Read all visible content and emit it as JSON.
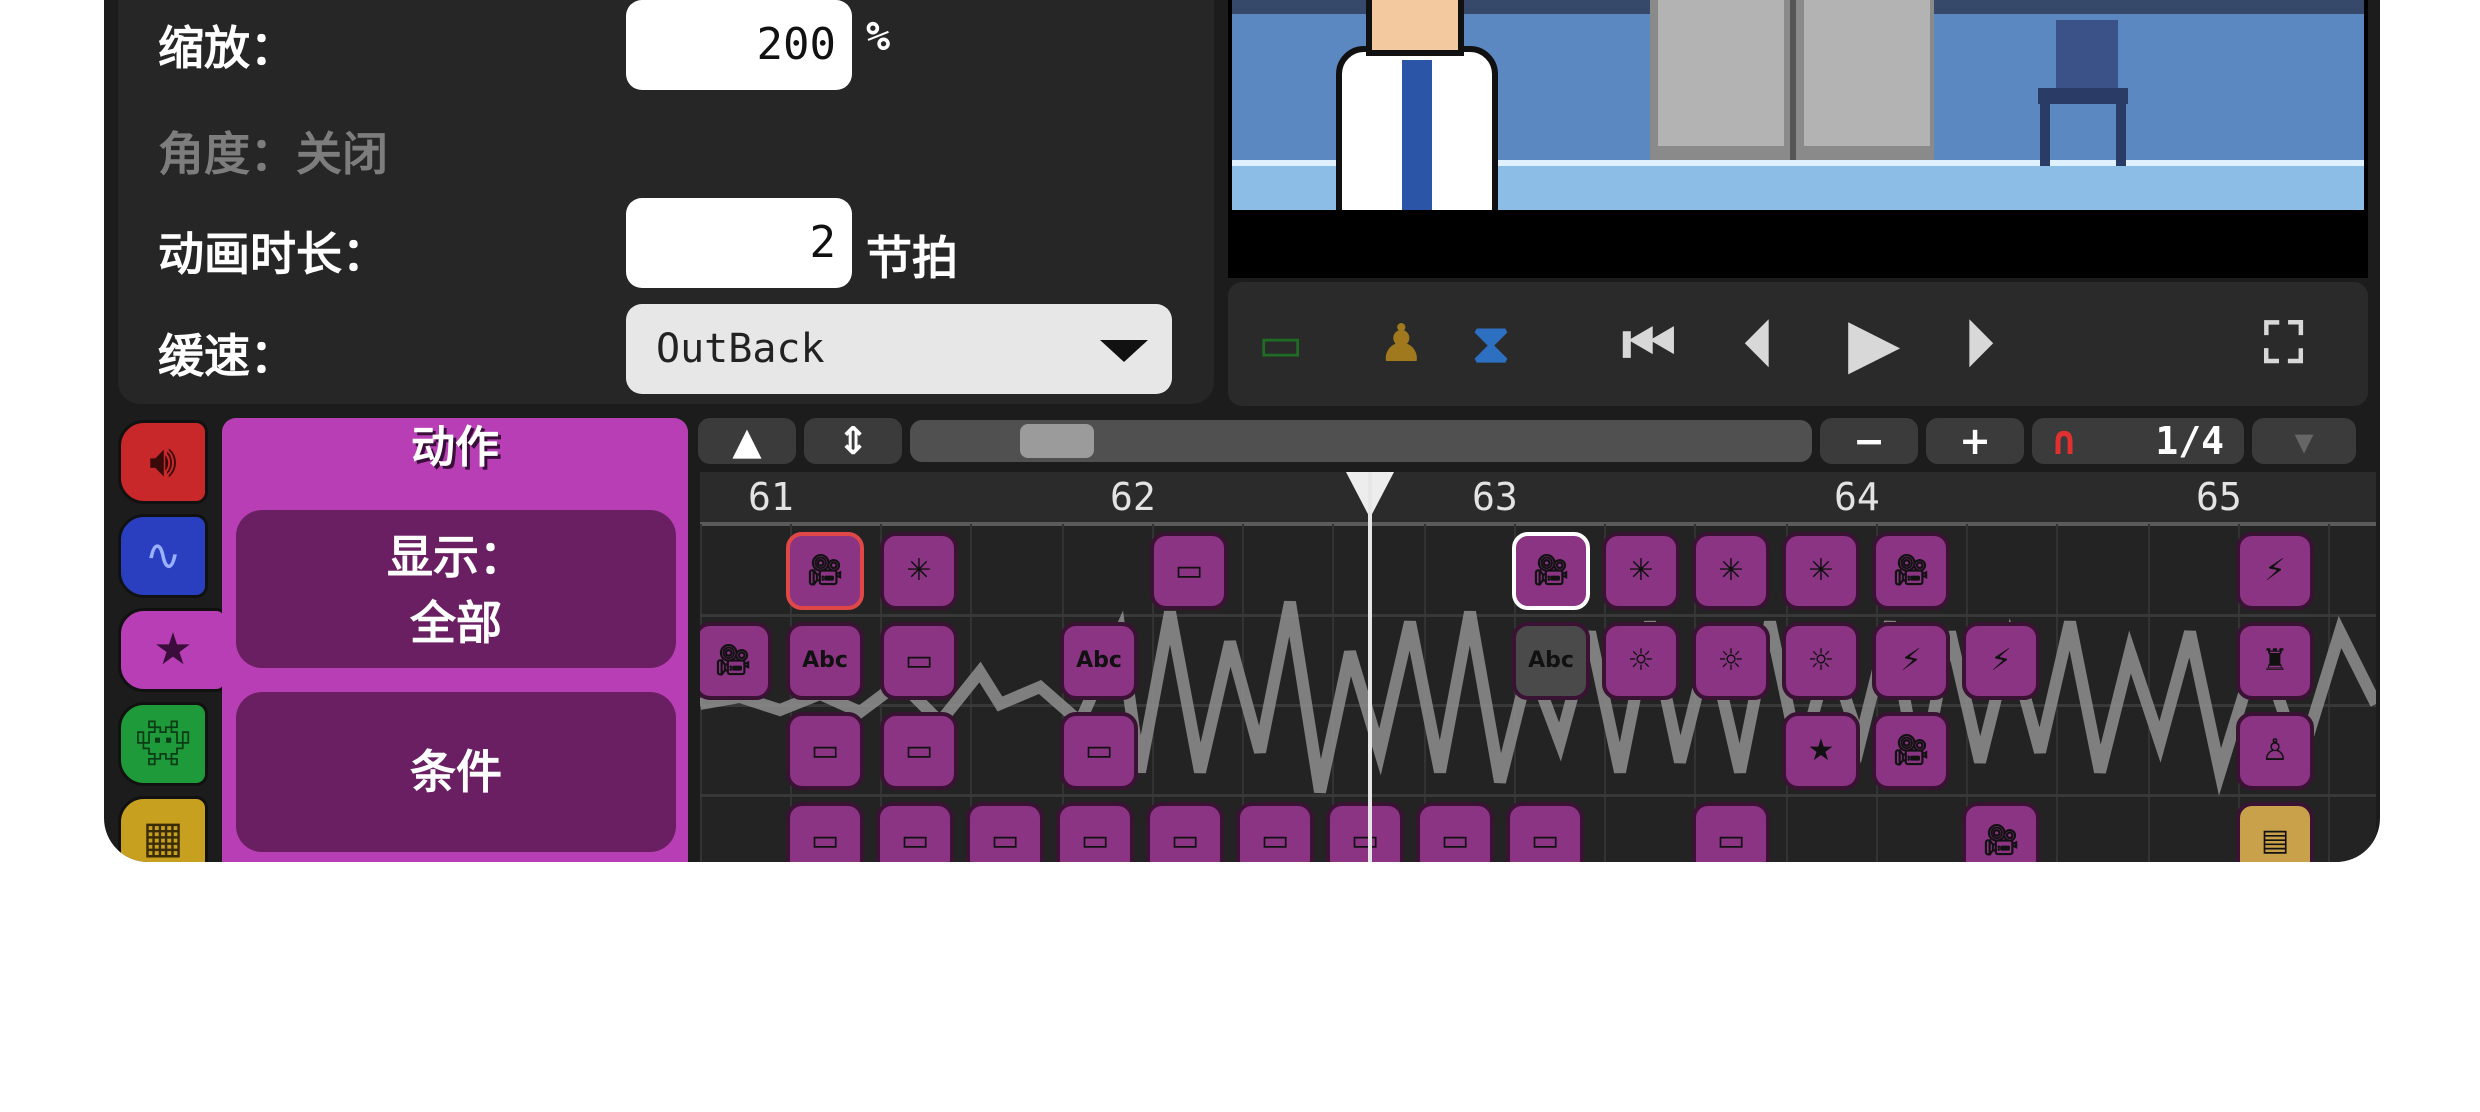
{
  "properties": {
    "scale_label": "缩放：",
    "scale_value": "200",
    "scale_unit": "%",
    "angle_label": "角度：关闭",
    "duration_label": "动画时长：",
    "duration_value": "2",
    "duration_unit": "节拍",
    "ease_label": "缓速：",
    "ease_value": "OutBack"
  },
  "playback": {
    "icons": [
      "camera-icon",
      "character-icon",
      "metronome-icon",
      "skip-to-start-icon",
      "previous-beat-icon",
      "play-icon",
      "next-beat-icon",
      "fullscreen-icon"
    ]
  },
  "categories": [
    {
      "name": "sound-icon",
      "color": "#c9282a"
    },
    {
      "name": "rhythm-icon",
      "color": "#2a3fbf"
    },
    {
      "name": "star-icon",
      "color": "#b83eb5"
    },
    {
      "name": "sprite-icon",
      "color": "#1e9a3a"
    },
    {
      "name": "grid-icon",
      "color": "#c8a020"
    }
  ],
  "actions_panel": {
    "title": "动作",
    "show_label_line1": "显示：",
    "show_label_line2": "全部",
    "conditions_label": "条件"
  },
  "timeline_toolbar": {
    "collapse": "▲",
    "expand": "⇕",
    "zoom_out": "−",
    "zoom_in": "+",
    "snap_icon": "magnet-icon",
    "snap_value": "1/4"
  },
  "timeline": {
    "beats": [
      "61",
      "62",
      "63",
      "64",
      "65"
    ],
    "playhead_beat": 62.75
  },
  "colors": {
    "panel_bg": "#262626",
    "accent_purple": "#b83eb5",
    "event_block": "#8a3483"
  }
}
